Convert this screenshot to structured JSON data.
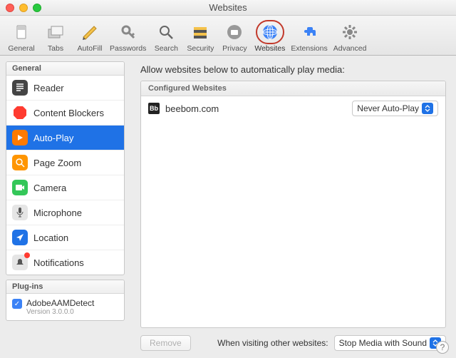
{
  "window": {
    "title": "Websites"
  },
  "toolbar": {
    "items": [
      {
        "id": "general",
        "label": "General"
      },
      {
        "id": "tabs",
        "label": "Tabs"
      },
      {
        "id": "autofill",
        "label": "AutoFill"
      },
      {
        "id": "passwords",
        "label": "Passwords"
      },
      {
        "id": "search",
        "label": "Search"
      },
      {
        "id": "security",
        "label": "Security"
      },
      {
        "id": "privacy",
        "label": "Privacy"
      },
      {
        "id": "websites",
        "label": "Websites"
      },
      {
        "id": "extensions",
        "label": "Extensions"
      },
      {
        "id": "advanced",
        "label": "Advanced"
      }
    ]
  },
  "sidebar": {
    "sections": [
      {
        "header": "General",
        "items": [
          {
            "label": "Reader"
          },
          {
            "label": "Content Blockers"
          },
          {
            "label": "Auto-Play"
          },
          {
            "label": "Page Zoom"
          },
          {
            "label": "Camera"
          },
          {
            "label": "Microphone"
          },
          {
            "label": "Location"
          },
          {
            "label": "Notifications"
          }
        ]
      },
      {
        "header": "Plug-ins",
        "plugins": [
          {
            "name": "AdobeAAMDetect",
            "version": "Version 3.0.0.0",
            "checked": true
          }
        ]
      }
    ]
  },
  "main": {
    "heading": "Allow websites below to automatically play media:",
    "configured_header": "Configured Websites",
    "rows": [
      {
        "icon": "Bb",
        "site": "beebom.com",
        "policy": "Never Auto-Play"
      }
    ],
    "remove_label": "Remove",
    "other_label": "When visiting other websites:",
    "other_value": "Stop Media with Sound"
  }
}
